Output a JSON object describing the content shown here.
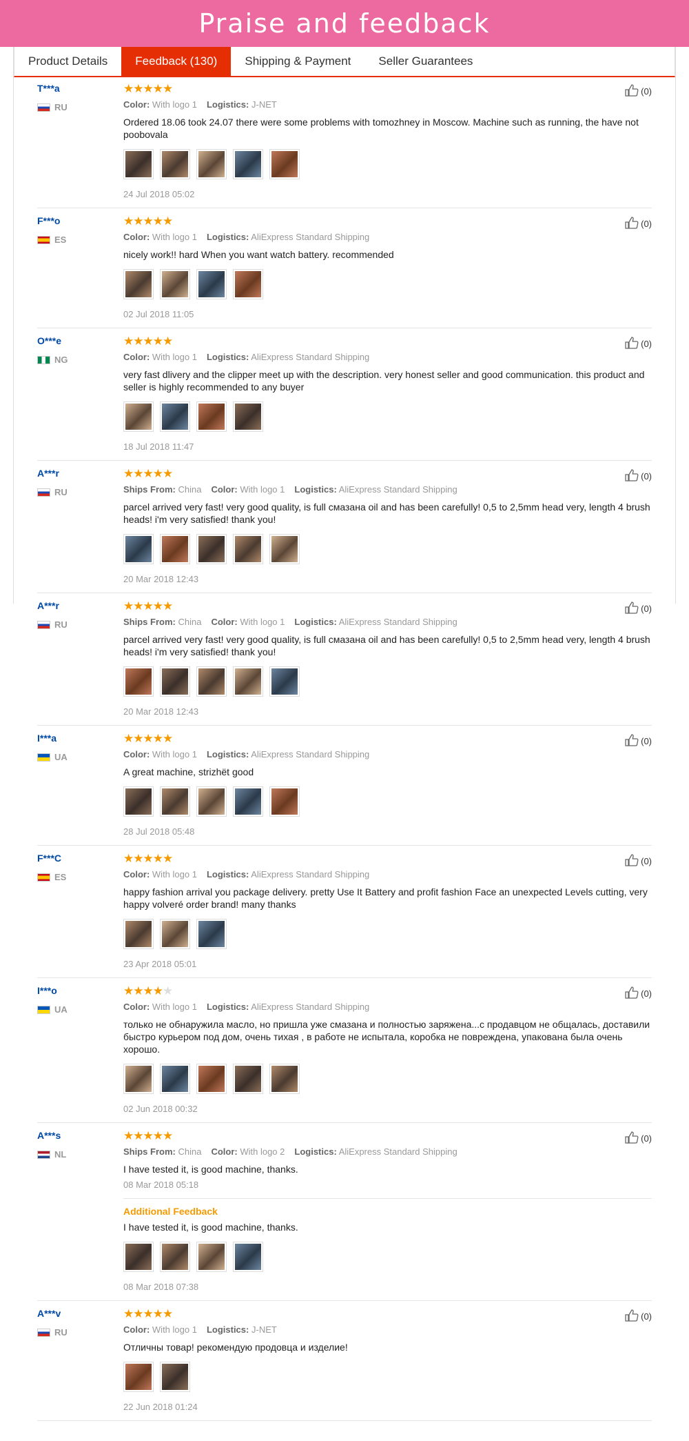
{
  "banner": {
    "title": "Praise and feedback"
  },
  "tabs": [
    {
      "label": "Product Details"
    },
    {
      "label": "Feedback (130)"
    },
    {
      "label": "Shipping & Payment"
    },
    {
      "label": "Seller Guarantees"
    }
  ],
  "labels": {
    "color": "Color:",
    "logistics": "Logistics:",
    "ships_from": "Ships From:",
    "additional_feedback": "Additional Feedback"
  },
  "colors": {
    "accent": "#e62e04",
    "banner": "#ec6a9f",
    "star": "#f59a00",
    "username": "#0049a5"
  },
  "reviews": [
    {
      "user": "T***a",
      "country": "RU",
      "rating": 5,
      "color": "With logo 1",
      "logistics": "J-NET",
      "text": "Ordered 18.06 took 24.07 there were some problems with tomozhney in Moscow. Machine such as running, the have not poobovala",
      "photos": 5,
      "date": "24 Jul 2018 05:02",
      "likes": "(0)"
    },
    {
      "user": "F***o",
      "country": "ES",
      "rating": 5,
      "color": "With logo 1",
      "logistics": "AliExpress Standard Shipping",
      "text": "nicely work!! hard When you want watch battery. recommended",
      "photos": 4,
      "date": "02 Jul 2018 11:05",
      "likes": "(0)"
    },
    {
      "user": "O***e",
      "country": "NG",
      "rating": 5,
      "color": "With logo 1",
      "logistics": "AliExpress Standard Shipping",
      "text": "very fast dlivery and the clipper meet up with the description. very honest seller and good communication. this product and seller is highly recommended to any buyer",
      "photos": 4,
      "date": "18 Jul 2018 11:47",
      "likes": "(0)"
    },
    {
      "user": "A***r",
      "country": "RU",
      "rating": 5,
      "ships_from": "China",
      "color": "With logo 1",
      "logistics": "AliExpress Standard Shipping",
      "text": "parcel arrived very fast! very good quality, is full смазана oil and has been carefully! 0,5 to 2,5mm head very, length 4 brush heads! i'm very satisfied! thank you!",
      "photos": 5,
      "date": "20 Mar 2018 12:43",
      "likes": "(0)"
    },
    {
      "user": "A***r",
      "country": "RU",
      "rating": 5,
      "ships_from": "China",
      "color": "With logo 1",
      "logistics": "AliExpress Standard Shipping",
      "text": "parcel arrived very fast! very good quality, is full смазана oil and has been carefully! 0,5 to 2,5mm head very, length 4 brush heads! i'm very satisfied! thank you!",
      "photos": 5,
      "date": "20 Mar 2018 12:43",
      "likes": "(0)"
    },
    {
      "user": "I***a",
      "country": "UA",
      "rating": 5,
      "color": "With logo 1",
      "logistics": "AliExpress Standard Shipping",
      "text": "A great machine, strizhёt good",
      "photos": 5,
      "date": "28 Jul 2018 05:48",
      "likes": "(0)"
    },
    {
      "user": "F***C",
      "country": "ES",
      "rating": 5,
      "color": "With logo 1",
      "logistics": "AliExpress Standard Shipping",
      "text": "happy fashion arrival you package delivery. pretty Use It Battery and profit fashion Face an unexpected Levels cutting, very happy volveré order brand! many thanks",
      "photos": 3,
      "date": "23 Apr 2018 05:01",
      "likes": "(0)"
    },
    {
      "user": "I***o",
      "country": "UA",
      "rating": 4,
      "color": "With logo 1",
      "logistics": "AliExpress Standard Shipping",
      "text": "только не обнаружила масло, но пришла уже смазана и полностью заряжена...с продавцом не общалась, доставили быстро курьером под дом, очень тихая , в работе не испытала, коробка не повреждена, упакована была очень хорошо.",
      "photos": 5,
      "date": "02 Jun 2018 00:32",
      "likes": "(0)"
    },
    {
      "user": "A***s",
      "country": "NL",
      "rating": 5,
      "ships_from": "China",
      "color": "With logo 2",
      "logistics": "AliExpress Standard Shipping",
      "text": "I have tested it, is good machine, thanks.",
      "photos": 0,
      "date": "08 Mar 2018 05:18",
      "likes": "(0)",
      "additional": {
        "text": "I have tested it, is good machine, thanks.",
        "photos": 4,
        "date": "08 Mar 2018 07:38"
      }
    },
    {
      "user": "A***v",
      "country": "RU",
      "rating": 5,
      "color": "With logo 1",
      "logistics": "J-NET",
      "text": "Отличны товар! рекомендую продовца и изделие!",
      "photos": 2,
      "date": "22 Jun 2018 01:24",
      "likes": "(0)"
    }
  ]
}
